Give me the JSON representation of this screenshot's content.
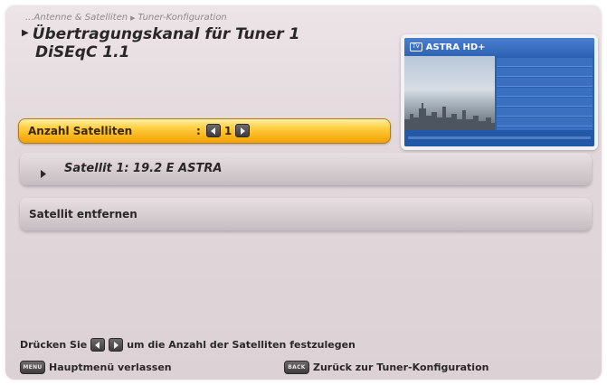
{
  "breadcrumb": {
    "items": [
      "...Antenne & Satelliten",
      "Tuner-Konfiguration"
    ]
  },
  "header": {
    "title_line1": "Übertragungskanal für Tuner 1",
    "title_line2": "DiSEqC 1.1"
  },
  "preview": {
    "channel_name": "ASTRA HD+",
    "tv_badge": "TV"
  },
  "settings": {
    "satellite_count": {
      "label": "Anzahl Satelliten",
      "separator": ":",
      "value": "1"
    }
  },
  "list": {
    "items": [
      {
        "label": "Satellit 1: 19.2 E ASTRA"
      },
      {
        "label": "Satellit entfernen"
      }
    ]
  },
  "hint": {
    "prefix": "Drücken Sie",
    "suffix": "um die Anzahl der Satelliten festzulegen"
  },
  "footer": {
    "menu_key": "MENU",
    "menu_label": "Hauptmenü verlassen",
    "back_key": "BACK",
    "back_label": "Zurück zur Tuner-Konfiguration"
  },
  "colors": {
    "highlight": "#f7ae12",
    "text": "#2a2728",
    "background": "#e2d8dc"
  }
}
